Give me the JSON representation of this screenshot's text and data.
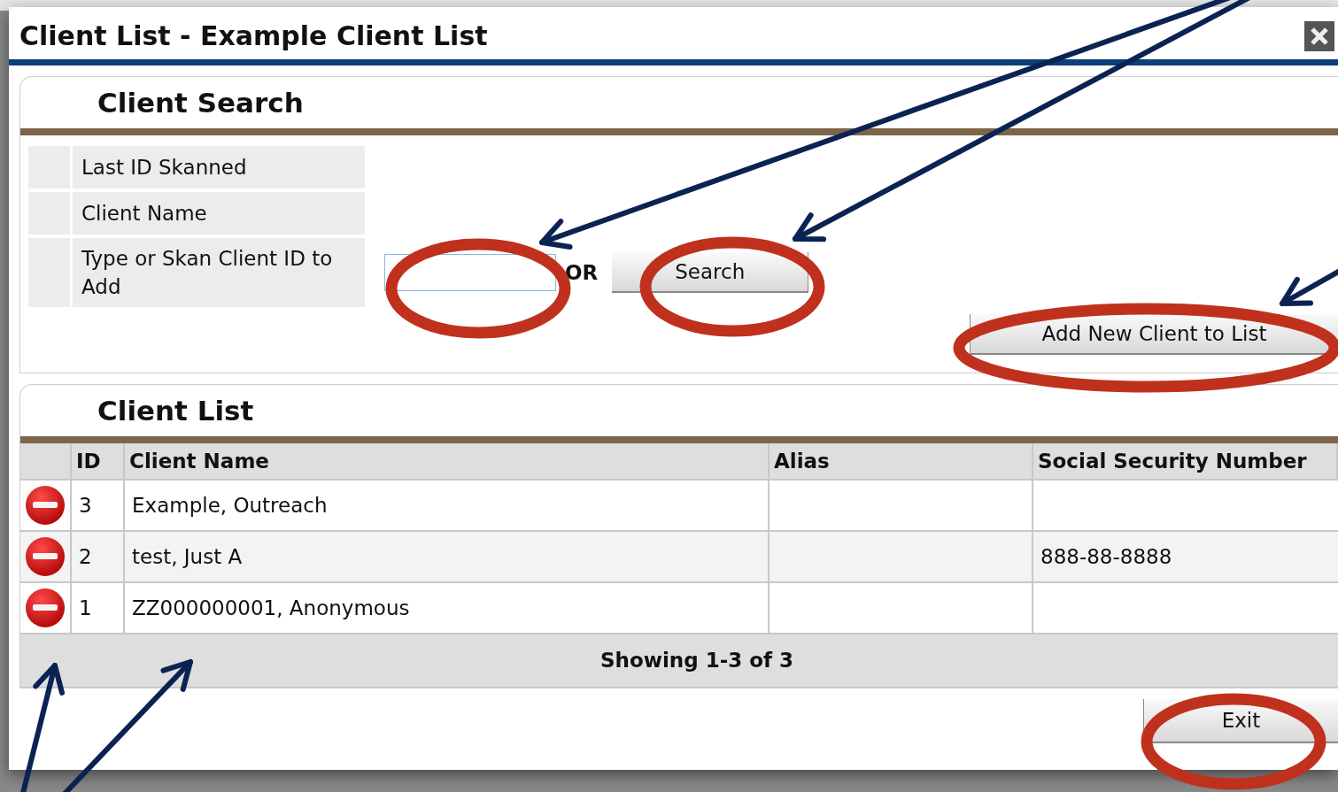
{
  "window": {
    "title": "Client List - Example Client List"
  },
  "search": {
    "heading": "Client Search",
    "fields": [
      {
        "label": "Last ID Skanned",
        "kind": "text"
      },
      {
        "label": "Client Name",
        "kind": "text"
      },
      {
        "label": "Type or Skan Client ID to Add",
        "kind": "input"
      }
    ],
    "or_label": "OR",
    "search_button": "Search",
    "add_button": "Add New Client to List"
  },
  "client_list": {
    "heading": "Client List",
    "columns": [
      "ID",
      "Client Name",
      "Alias",
      "Social Security Number"
    ],
    "rows": [
      {
        "id": "3",
        "client_name": "Example, Outreach"
      },
      {
        "id": "2",
        "client_name": "test, Just A",
        "ssn": "888-88-8888"
      },
      {
        "id": "1",
        "client_name": "ZZ000000001, Anonymous"
      }
    ],
    "footer": "Showing 1-3 of 3"
  },
  "exit_button": "Exit"
}
